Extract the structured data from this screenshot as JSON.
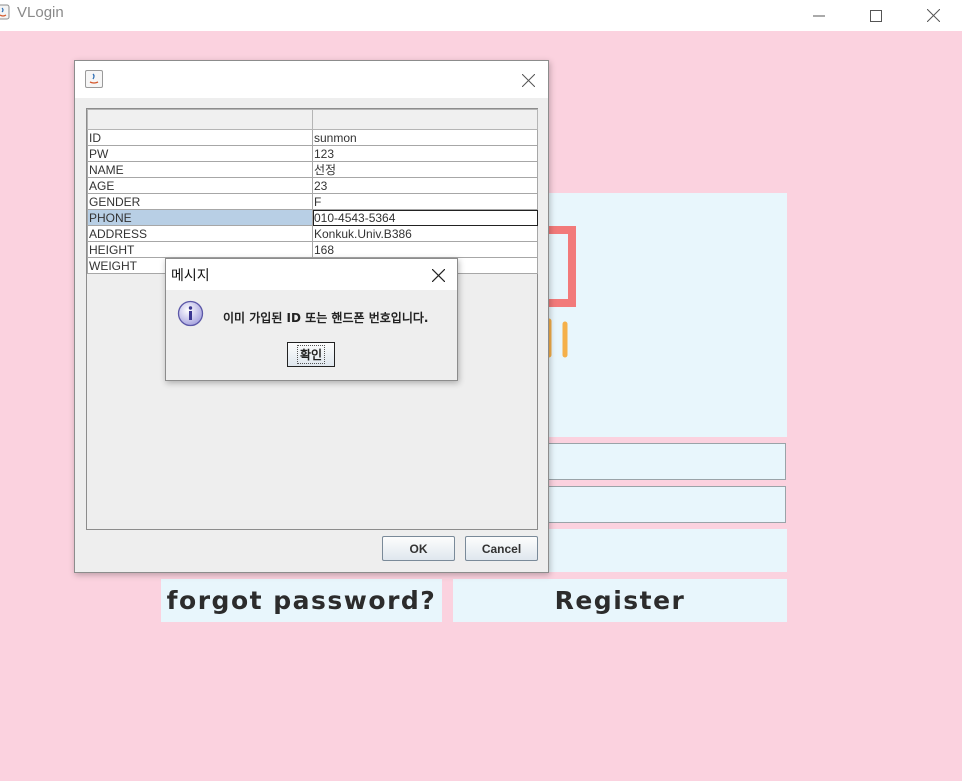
{
  "window": {
    "title": "VLogin",
    "controls": [
      "minimize-icon",
      "maximize-icon",
      "close-icon"
    ]
  },
  "login": {
    "forgot_label": "forgot password?",
    "register_label": "Register"
  },
  "member_dialog": {
    "columns": [
      "",
      ""
    ],
    "rows": [
      {
        "key": "ID",
        "value": "sunmon"
      },
      {
        "key": "PW",
        "value": "123"
      },
      {
        "key": "NAME",
        "value": "선정"
      },
      {
        "key": "AGE",
        "value": "23"
      },
      {
        "key": "GENDER",
        "value": "F"
      },
      {
        "key": "PHONE",
        "value": "010-4543-5364"
      },
      {
        "key": "ADDRESS",
        "value": "Konkuk.Univ.B386"
      },
      {
        "key": "HEIGHT",
        "value": "168"
      },
      {
        "key": "WEIGHT",
        "value": ""
      }
    ],
    "selected_row": "PHONE",
    "ok_label": "OK",
    "cancel_label": "Cancel"
  },
  "message_dialog": {
    "title": "메시지",
    "icon": "info-icon",
    "text": "이미 가입된 ID 또는 핸드폰 번호입니다.",
    "confirm_label": "확인"
  },
  "colors": {
    "background": "#fbd2df",
    "panel": "#e8f6fc",
    "logo_red": "#f27a7a",
    "logo_orange": "#f5b04a",
    "selection": "#b8cfe5"
  }
}
